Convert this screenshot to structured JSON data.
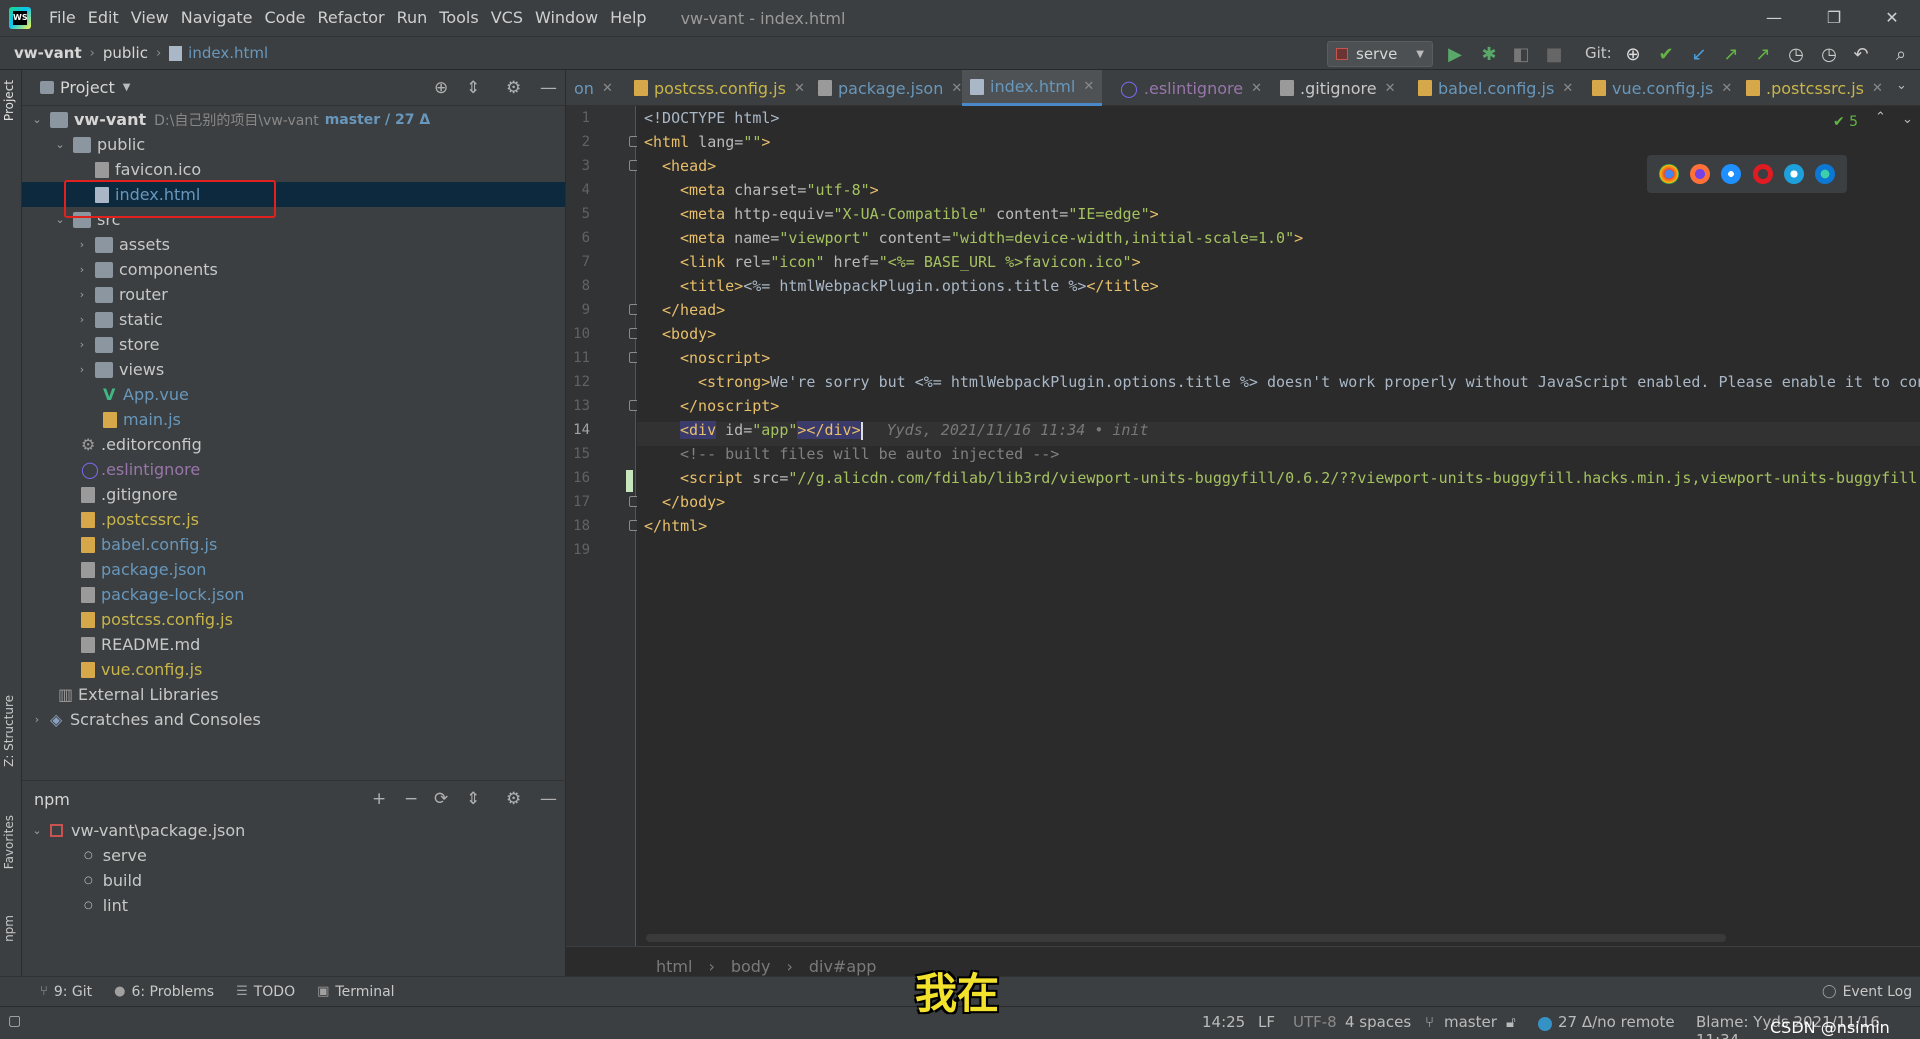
{
  "menu": {
    "logo_text": "WS",
    "items": [
      "File",
      "Edit",
      "View",
      "Navigate",
      "Code",
      "Refactor",
      "Run",
      "Tools",
      "VCS",
      "Window",
      "Help"
    ],
    "window_title": "vw-vant - index.html"
  },
  "window_controls": {
    "minimize": "—",
    "restore": "❐",
    "close": "✕"
  },
  "navbar": {
    "crumbs": [
      "vw-vant",
      "public",
      "index.html"
    ],
    "run_config": "serve",
    "git_label": "Git:"
  },
  "left_strip": {
    "project": "Project",
    "structure": "Z: Structure",
    "favorites": "Favorites",
    "npm": "npm"
  },
  "project_panel": {
    "title": "Project",
    "root": {
      "name": "vw-vant",
      "path": "D:\\自己别的项目\\vw-vant",
      "branch": "master / 27 Δ"
    },
    "items": [
      {
        "label": "public"
      },
      {
        "label": "favicon.ico"
      },
      {
        "label": "index.html"
      },
      {
        "label": "src"
      },
      {
        "label": "assets"
      },
      {
        "label": "components"
      },
      {
        "label": "router"
      },
      {
        "label": "static"
      },
      {
        "label": "store"
      },
      {
        "label": "views"
      },
      {
        "label": "App.vue"
      },
      {
        "label": "main.js"
      },
      {
        "label": ".editorconfig"
      },
      {
        "label": ".eslintignore"
      },
      {
        "label": ".gitignore"
      },
      {
        "label": ".postcssrc.js"
      },
      {
        "label": "babel.config.js"
      },
      {
        "label": "package.json"
      },
      {
        "label": "package-lock.json"
      },
      {
        "label": "postcss.config.js"
      },
      {
        "label": "README.md"
      },
      {
        "label": "vue.config.js"
      },
      {
        "label": "External Libraries"
      },
      {
        "label": "Scratches and Consoles"
      }
    ]
  },
  "npm_panel": {
    "title": "npm",
    "package": "vw-vant\\package.json",
    "scripts": [
      "serve",
      "build",
      "lint"
    ]
  },
  "tabs": [
    {
      "label": "on"
    },
    {
      "label": "postcss.config.js"
    },
    {
      "label": "package.json"
    },
    {
      "label": "index.html"
    },
    {
      "label": ".eslintignore"
    },
    {
      "label": ".gitignore"
    },
    {
      "label": "babel.config.js"
    },
    {
      "label": "vue.config.js"
    },
    {
      "label": ".postcssrc.js"
    }
  ],
  "tab_close": "✕",
  "editor": {
    "line_numbers": [
      "1",
      "2",
      "3",
      "4",
      "5",
      "6",
      "7",
      "8",
      "9",
      "10",
      "11",
      "12",
      "13",
      "14",
      "15",
      "16",
      "17",
      "18",
      "19"
    ],
    "inspections": "✔ 5",
    "blame_inline": "Yyds, 2021/11/16 11:34 • init",
    "lines": {
      "l1": "<!DOCTYPE html>",
      "l2a": "<html",
      "l2b": " lang=",
      "l2c": "\"\"",
      "l2d": ">",
      "l3": "<head>",
      "l4a": "<meta",
      "l4b": " charset=",
      "l4c": "\"utf-8\"",
      "l4d": ">",
      "l5a": "<meta",
      "l5b": " http-equiv=",
      "l5c": "\"X-UA-Compatible\"",
      "l5d": " content=",
      "l5e": "\"IE=edge\"",
      "l5f": ">",
      "l6a": "<meta",
      "l6b": " name=",
      "l6c": "\"viewport\"",
      "l6d": " content=",
      "l6e": "\"width=device-width,initial-scale=1.0\"",
      "l6f": ">",
      "l7a": "<link",
      "l7b": " rel=",
      "l7c": "\"icon\"",
      "l7d": " href=",
      "l7e": "\"<%= BASE_URL %>favicon.ico\"",
      "l7f": ">",
      "l8a": "<title>",
      "l8b": "<%= htmlWebpackPlugin.options.title %>",
      "l8c": "</title>",
      "l9": "</head>",
      "l10": "<body>",
      "l11": "<noscript>",
      "l12a": "<strong>",
      "l12b": "We're sorry but <%= htmlWebpackPlugin.options.title %> doesn't work properly without JavaScript enabled. Please enable it to con",
      "l13": "</noscript>",
      "l14a": "<div",
      "l14b": " id=",
      "l14c": "\"app\"",
      "l14d": "></div>",
      "l15": "<!-- built files will be auto injected -->",
      "l16a": "<script",
      "l16b": " src=",
      "l16c": "\"//g.alicdn.com/fdilab/lib3rd/viewport-units-buggyfill/0.6.2/??viewport-units-buggyfill.hacks.min.js,viewport-units-buggyfill.",
      "l17": "</body>",
      "l18": "</html>"
    }
  },
  "editor_breadcrumbs": [
    "html",
    "body",
    "div#app"
  ],
  "bottom_tabs": {
    "git": "9: Git",
    "problems": "6: Problems",
    "todo": "TODO",
    "terminal": "Terminal",
    "event_log": "Event Log"
  },
  "status": {
    "position": "14:25",
    "line_sep": "LF",
    "encoding": "UTF-8",
    "indent": "4 spaces",
    "branch": "master",
    "remote": "27 Δ/no remote",
    "blame": "Blame: Yyds 2021/11/16 11:34",
    "watermark": "CSDN @nsimin"
  },
  "overlay_subtitle": "我在",
  "colors": {
    "accent": "#4a88c7",
    "highlight_box": "#e0211e",
    "selection": "#0d293e"
  }
}
